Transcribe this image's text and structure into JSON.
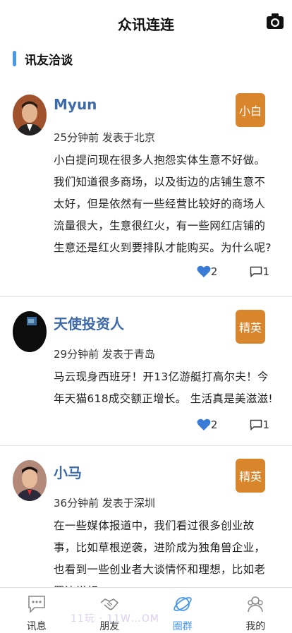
{
  "header": {
    "title": "众讯连连",
    "camera_icon": "camera-icon"
  },
  "section": {
    "label": "讯友洽谈",
    "accent": "#4a98e8"
  },
  "posts": [
    {
      "name": "Myun",
      "time": "25分钟前 发表于北京",
      "badge": "小白",
      "content": "小白提问现在很多人抱怨实体生意不好做。我们知道很多商场，以及街边的店铺生意不太好，但是依然有一些经营比较好的商场人流量很大，生意很红火，有一些网红店铺的生意还是红火到要排队才能购买。为什么呢?",
      "likes": "2",
      "comments": "1"
    },
    {
      "name": "天使投资人",
      "time": "29分钟前 发表于青岛",
      "badge": "精英",
      "content": "马云现身西班牙！开13亿游艇打高尔夫！今年天猫618成交额正增长。 生活真是美滋滋!",
      "likes": "2",
      "comments": "1"
    },
    {
      "name": "小马",
      "time": "36分钟前 发表于深圳",
      "badge": "精英",
      "content": "在一些媒体报道中，我们看过很多创业故事，比如草根逆袭，进阶成为独角兽企业，也看到一些创业者大谈情怀和理想，比如老罗边说相",
      "likes": "",
      "comments": ""
    }
  ],
  "tabs": [
    {
      "label": "讯息",
      "icon": "message-icon"
    },
    {
      "label": "朋友",
      "icon": "handshake-icon"
    },
    {
      "label": "圈群",
      "icon": "planet-icon"
    },
    {
      "label": "我的",
      "icon": "user-icon"
    }
  ],
  "watermark": "11玩 · 11W…OM",
  "colors": {
    "badge": "#d9852c",
    "name": "#3d6aa8",
    "heart": "#3a7bd5",
    "active_tab": "#4a98e8"
  }
}
